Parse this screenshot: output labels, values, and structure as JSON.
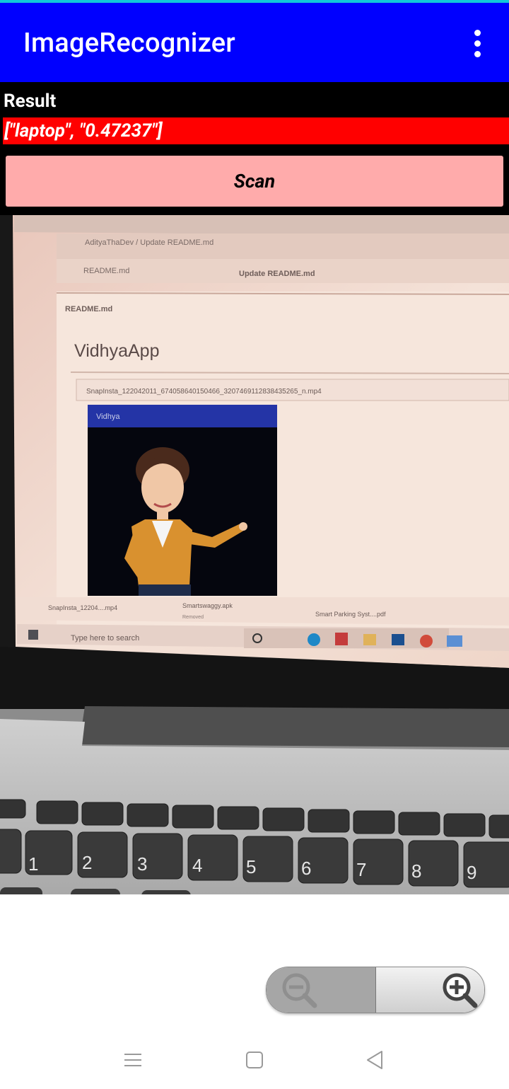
{
  "app": {
    "title": "ImageRecognizer"
  },
  "result": {
    "label": "Result",
    "value": "[\"laptop\", \"0.47237\"]"
  },
  "scan_button": {
    "label": "Scan"
  },
  "camera_preview": {
    "browser_tab": "AdityaThaDev / Update README.md",
    "file_header": "README.md",
    "commit_message": "Update README.md",
    "readme_label": "README.md",
    "page_heading": "VidhyaApp",
    "video_filename": "SnapInsta_122042011_674058640150466_3207469112838435265_n.mp4",
    "video_app_title": "Vidhya",
    "downloads": [
      {
        "name": "SnapInsta_12204....mp4",
        "status": ""
      },
      {
        "name": "Smartswaggy.apk",
        "status": "Removed"
      },
      {
        "name": "Smart Parking Syst....pdf",
        "status": ""
      }
    ],
    "taskbar_search_placeholder": "Type here to search"
  },
  "zoom_controls": {
    "zoom_out_icon": "zoom-out-icon",
    "zoom_in_icon": "zoom-in-icon"
  },
  "system_nav": {
    "menu_icon": "menu-icon",
    "home_icon": "home-square-icon",
    "back_icon": "back-triangle-icon"
  },
  "colors": {
    "app_bar": "#0000ff",
    "result_bg": "#000000",
    "result_value_bg": "#ff0000",
    "scan_button_bg": "#ffabab",
    "status_strip": "#11c8d8"
  }
}
